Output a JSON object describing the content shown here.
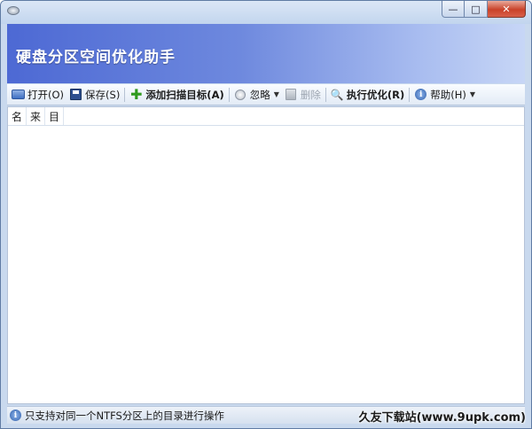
{
  "window": {
    "title": "",
    "controls": {
      "minimize": "—",
      "maximize": "□",
      "close": "✕"
    }
  },
  "banner": {
    "title": "硬盘分区空间优化助手"
  },
  "toolbar": {
    "open": "打开(O)",
    "save": "保存(S)",
    "add_target": "添加扫描目标(A)",
    "ignore": "忽略",
    "delete": "删除",
    "execute": "执行优化(R)",
    "help": "帮助(H)"
  },
  "list": {
    "columns": [
      "名",
      "来",
      "目"
    ],
    "rows": []
  },
  "status": {
    "text": "只支持对同一个NTFS分区上的目录进行操作"
  },
  "watermark": {
    "text": "久友下载站(www.9upk.com)"
  },
  "icons": {
    "app": "app-icon",
    "open": "folder-icon",
    "save": "floppy-disk-icon",
    "add": "plus-icon",
    "ignore": "ignore-icon",
    "delete": "delete-icon",
    "execute": "magnifier-icon",
    "help": "help-icon",
    "status": "info-icon"
  },
  "colors": {
    "banner_start": "#4d69d4",
    "banner_end": "#c7d6f6",
    "add_green": "#2f9a1e"
  }
}
